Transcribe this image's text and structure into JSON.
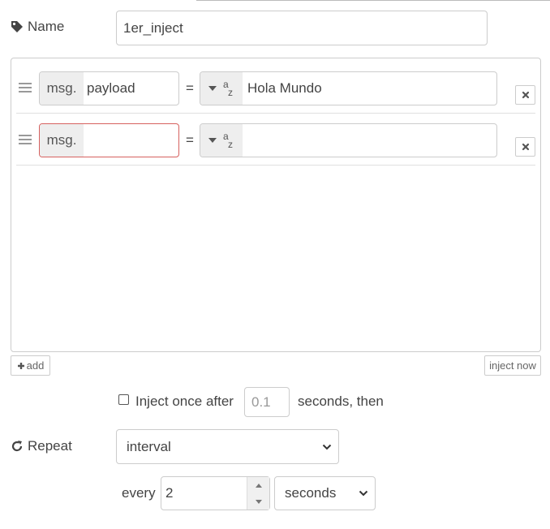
{
  "name": {
    "label": "Name",
    "value": "1er_inject",
    "icon": "tag-icon"
  },
  "properties": [
    {
      "prefix": "msg.",
      "property": "payload",
      "operator": "=",
      "type_icon": "az-icon",
      "value": "Hola Mundo"
    },
    {
      "prefix": "msg.",
      "property": "",
      "operator": "=",
      "type_icon": "az-icon",
      "value": ""
    }
  ],
  "buttons": {
    "add": "add",
    "inject_now": "inject now"
  },
  "inject_once": {
    "label": "Inject once after",
    "delay": "0.1",
    "suffix": "seconds, then",
    "checked": false
  },
  "repeat": {
    "label": "Repeat",
    "mode": "interval",
    "icon": "refresh-icon"
  },
  "interval": {
    "every_label": "every",
    "value": "2",
    "unit": "seconds"
  },
  "colors": {
    "error_border": "#d6615f",
    "border": "#cccccc",
    "prefix_bg": "#eeeeee"
  }
}
